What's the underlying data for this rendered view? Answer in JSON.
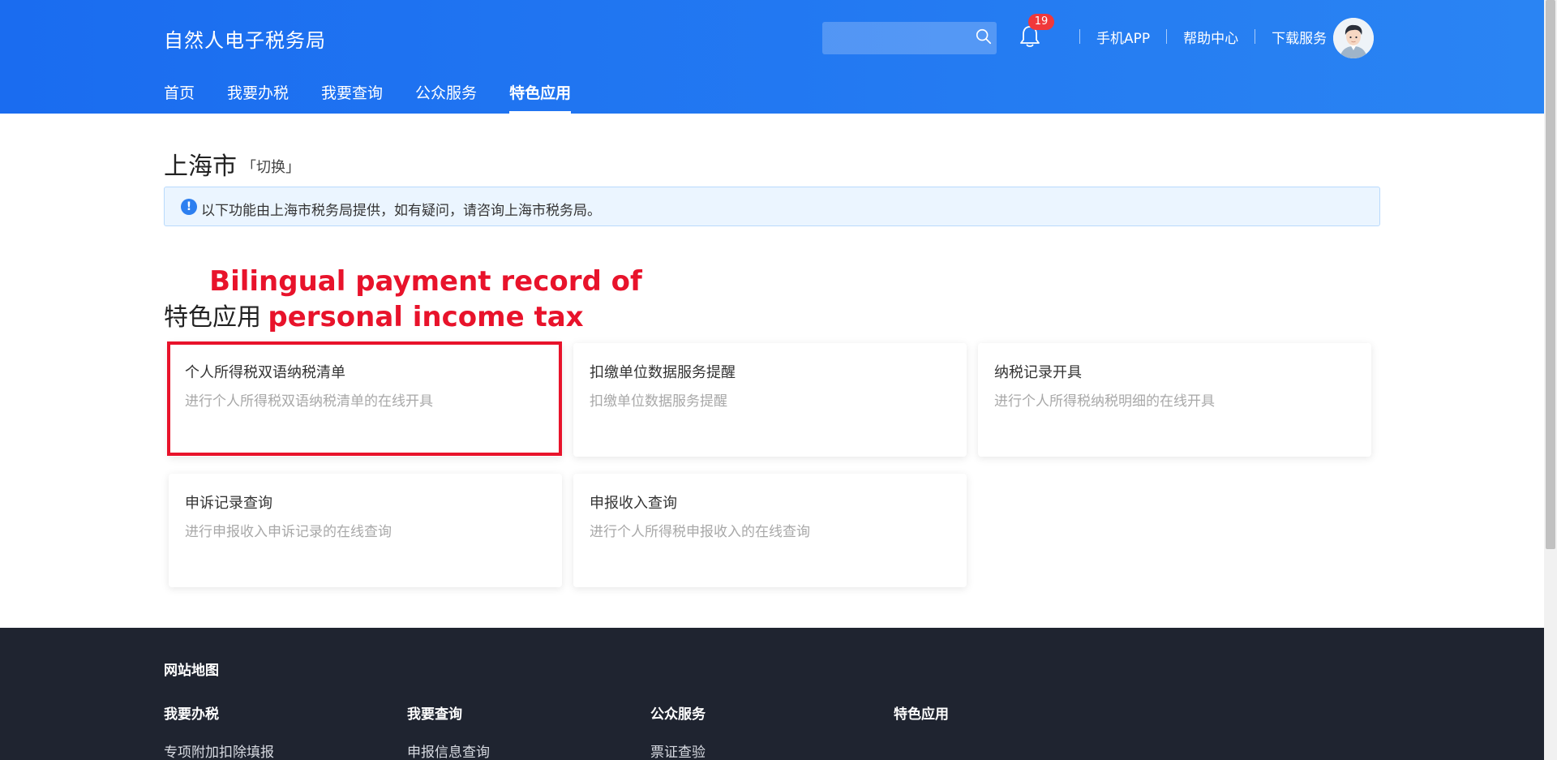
{
  "header": {
    "logo": "自然人电子税务局",
    "search": {
      "value": "",
      "placeholder": ""
    },
    "notifications": {
      "count": "19"
    },
    "links": [
      "手机APP",
      "帮助中心",
      "下载服务"
    ],
    "nav": [
      {
        "label": "首页",
        "active": false
      },
      {
        "label": "我要办税",
        "active": false
      },
      {
        "label": "我要查询",
        "active": false
      },
      {
        "label": "公众服务",
        "active": false
      },
      {
        "label": "特色应用",
        "active": true
      }
    ]
  },
  "main": {
    "city": "上海市",
    "switch_label": "「切换」",
    "notice": "以下功能由上海市税务局提供，如有疑问，请咨询上海市税务局。",
    "annotation": "Bilingual payment record of personal income tax",
    "section_title": "特色应用",
    "cards": [
      {
        "title": "个人所得税双语纳税清单",
        "desc": "进行个人所得税双语纳税清单的在线开具"
      },
      {
        "title": "扣缴单位数据服务提醒",
        "desc": "扣缴单位数据服务提醒"
      },
      {
        "title": "纳税记录开具",
        "desc": "进行个人所得税纳税明细的在线开具"
      },
      {
        "title": "申诉记录查询",
        "desc": "进行申报收入申诉记录的在线查询"
      },
      {
        "title": "申报收入查询",
        "desc": "进行个人所得税申报收入的在线查询"
      }
    ]
  },
  "footer": {
    "map_title": "网站地图",
    "columns": [
      {
        "title": "我要办税",
        "items": [
          "专项附加扣除填报"
        ]
      },
      {
        "title": "我要查询",
        "items": [
          "申报信息查询"
        ]
      },
      {
        "title": "公众服务",
        "items": [
          "票证查验"
        ]
      },
      {
        "title": "特色应用",
        "items": []
      }
    ]
  },
  "colors": {
    "header_start": "#1a6cf0",
    "header_end": "#2a84f3",
    "annotation": "#e8132b",
    "footer_bg": "#1f2430"
  }
}
